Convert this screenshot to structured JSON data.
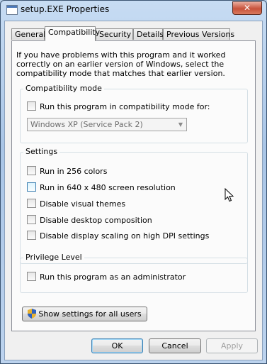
{
  "window": {
    "title": "setup.EXE Properties",
    "close_glyph": "✕"
  },
  "tabs": [
    "General",
    "Compatibility",
    "Security",
    "Details",
    "Previous Versions"
  ],
  "active_tab": "Compatibility",
  "intro_text": "If you have problems with this program and it worked correctly on an earlier version of Windows, select the compatibility mode that matches that earlier version.",
  "compat_mode": {
    "title": "Compatibility mode",
    "checkbox_label": "Run this program in compatibility mode for:",
    "checked": false,
    "select_value": "Windows XP (Service Pack 2)"
  },
  "settings": {
    "title": "Settings",
    "options": [
      {
        "label": "Run in 256 colors",
        "checked": false
      },
      {
        "label": "Run in 640 x 480 screen resolution",
        "checked": false
      },
      {
        "label": "Disable visual themes",
        "checked": false
      },
      {
        "label": "Disable desktop composition",
        "checked": false
      },
      {
        "label": "Disable display scaling on high DPI settings",
        "checked": false
      }
    ]
  },
  "privilege": {
    "title": "Privilege Level",
    "checkbox_label": "Run this program as an administrator",
    "checked": false
  },
  "show_all_users_button": "Show settings for all users",
  "buttons": {
    "ok": "OK",
    "cancel": "Cancel",
    "apply": "Apply"
  }
}
